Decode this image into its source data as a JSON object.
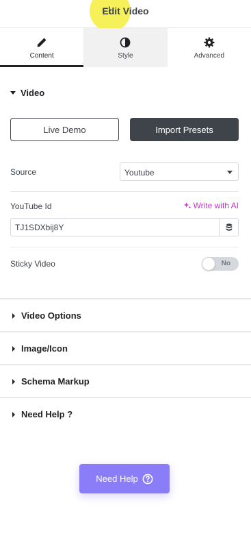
{
  "header": {
    "title": "Edit Video"
  },
  "tabs": [
    {
      "label": "Content",
      "icon": "pencil-icon",
      "active": true
    },
    {
      "label": "Style",
      "icon": "half-circle-icon",
      "active": false
    },
    {
      "label": "Advanced",
      "icon": "gear-icon",
      "active": false
    }
  ],
  "video_section": {
    "title": "Video",
    "live_demo_label": "Live Demo",
    "import_presets_label": "Import Presets",
    "source": {
      "label": "Source",
      "value": "Youtube"
    },
    "youtube_id": {
      "label": "YouTube Id",
      "value": "TJ1SDXbij8Y",
      "ai_link": "Write with AI"
    },
    "sticky_video": {
      "label": "Sticky Video",
      "toggle_text": "No",
      "enabled": false
    }
  },
  "sections": [
    {
      "title": "Video Options"
    },
    {
      "title": "Image/Icon"
    },
    {
      "title": "Schema Markup"
    },
    {
      "title": "Need Help ?"
    }
  ],
  "help_button": {
    "label": "Need Help"
  },
  "colors": {
    "primary_dark": "#3f444b",
    "ai_accent": "#c036c7",
    "help_button": "#8b7cf8",
    "cursor_highlight": "#f6ef3c"
  }
}
